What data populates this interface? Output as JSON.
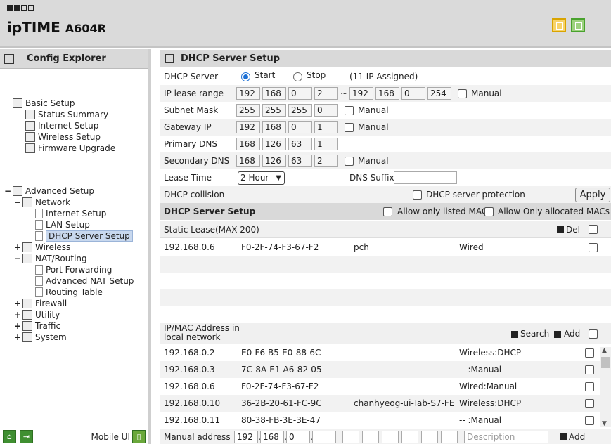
{
  "header": {
    "brand": "ipTIME",
    "model": "A604R"
  },
  "sidebar": {
    "title": "Config Explorer",
    "items": [
      {
        "label": "Basic Setup"
      },
      {
        "label": "Status Summary"
      },
      {
        "label": "Internet Setup"
      },
      {
        "label": "Wireless Setup"
      },
      {
        "label": "Firmware Upgrade"
      },
      {
        "label": "Advanced Setup"
      },
      {
        "label": "Network"
      },
      {
        "label": "Internet Setup"
      },
      {
        "label": "LAN Setup"
      },
      {
        "label": "DHCP Server Setup"
      },
      {
        "label": "Wireless"
      },
      {
        "label": "NAT/Routing"
      },
      {
        "label": "Port Forwarding"
      },
      {
        "label": "Advanced NAT Setup"
      },
      {
        "label": "Routing Table"
      },
      {
        "label": "Firewall"
      },
      {
        "label": "Utility"
      },
      {
        "label": "Traffic"
      },
      {
        "label": "System"
      }
    ],
    "mobile_ui": "Mobile UI"
  },
  "main": {
    "title": "DHCP Server Setup",
    "dhcp_server": {
      "label": "DHCP Server",
      "start": "Start",
      "stop": "Stop",
      "assigned": "(11 IP Assigned)"
    },
    "ip_lease": {
      "label": "IP lease range",
      "from": [
        "192",
        "168",
        "0",
        "2"
      ],
      "to": [
        "192",
        "168",
        "0",
        "254"
      ],
      "tilde": "~",
      "manual": "Manual"
    },
    "subnet": {
      "label": "Subnet Mask",
      "value": [
        "255",
        "255",
        "255",
        "0"
      ],
      "manual": "Manual"
    },
    "gateway": {
      "label": "Gateway IP",
      "value": [
        "192",
        "168",
        "0",
        "1"
      ],
      "manual": "Manual"
    },
    "primary_dns": {
      "label": "Primary DNS",
      "value": [
        "168",
        "126",
        "63",
        "1"
      ]
    },
    "secondary_dns": {
      "label": "Secondary DNS",
      "value": [
        "168",
        "126",
        "63",
        "2"
      ],
      "manual": "Manual"
    },
    "lease_time": {
      "label": "Lease Time",
      "value": "2 Hour",
      "dns_suffix": "DNS Suffix"
    },
    "collision": {
      "label": "DHCP collision",
      "protection": "DHCP server protection",
      "apply": "Apply"
    },
    "setup2": {
      "title": "DHCP Server Setup",
      "allow_listed": "Allow only listed MACs",
      "allow_allocated": "Allow Only allocated MACs"
    },
    "static_lease": {
      "title": "Static Lease(MAX 200)",
      "del": "Del",
      "rows": [
        {
          "ip": "192.168.0.6",
          "mac": "F0-2F-74-F3-67-F2",
          "name": "pch",
          "type": "Wired"
        }
      ]
    },
    "ipmac": {
      "title": "IP/MAC Address in local network",
      "search": "Search",
      "add": "Add",
      "rows": [
        {
          "ip": "192.168.0.2",
          "mac": "E0-F6-B5-E0-88-6C",
          "name": "",
          "type": "Wireless:DHCP"
        },
        {
          "ip": "192.168.0.3",
          "mac": "7C-8A-E1-A6-82-05",
          "name": "",
          "type": "-- :Manual"
        },
        {
          "ip": "192.168.0.6",
          "mac": "F0-2F-74-F3-67-F2",
          "name": "",
          "type": "Wired:Manual"
        },
        {
          "ip": "192.168.0.10",
          "mac": "36-2B-20-61-FC-9C",
          "name": "chanhyeog-ui-Tab-S7-FE",
          "type": "Wireless:DHCP"
        },
        {
          "ip": "192.168.0.11",
          "mac": "80-38-FB-3E-3E-47",
          "name": "",
          "type": "-- :Manual"
        }
      ]
    },
    "manual_address": {
      "label": "Manual address",
      "ip": [
        "192",
        "168",
        "0",
        ""
      ],
      "description_placeholder": "Description",
      "add": "Add"
    }
  }
}
